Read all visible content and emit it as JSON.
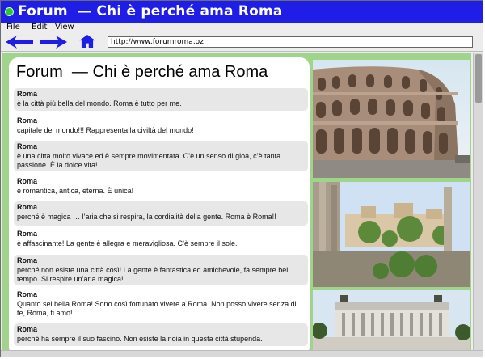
{
  "window": {
    "title": "Forum  — Chi è perché ama Roma"
  },
  "menu": {
    "items": [
      "File",
      "Edit",
      "View"
    ]
  },
  "toolbar": {
    "url": "http://www.forumroma.oz"
  },
  "page": {
    "heading": "Forum  — Chi è perché ama Roma",
    "posts": [
      {
        "author": "Roma",
        "text": "è la città più bella del mondo. Roma è tutto per me."
      },
      {
        "author": "Roma",
        "text": "capitale del mondo!!! Rappresenta la civiltà del mondo!"
      },
      {
        "author": "Roma",
        "text": "è una città molto vivace ed è sempre movimentata. C’è un senso di gioa, c’è tanta passione. È la dolce vita!"
      },
      {
        "author": "Roma",
        "text": "è romantica, antica, eterna. È unica!"
      },
      {
        "author": "Roma",
        "text": "perché è magica … l’aria che si respira, la cordialità della gente. Roma è Roma!!"
      },
      {
        "author": "Roma",
        "text": "è affascinante! La gente è allegra e meravigliosa. C’è sempre il sole."
      },
      {
        "author": "Roma",
        "text": "perché non esiste una città così! La gente è fantastica ed amichevole, fa sempre bel tempo. Si respire un’aria magica!"
      },
      {
        "author": "Roma",
        "text": "Quanto sei bella Roma! Sono così fortunato vivere a Roma. Non posso vivere senza di te, Roma, ti amo!"
      },
      {
        "author": "Roma",
        "text": "perché ha sempre il suo fascino. Non esiste la noia in questa città stupenda."
      }
    ]
  },
  "icons": {
    "back": "left-arrow-icon",
    "forward": "right-arrow-icon",
    "home": "home-icon"
  },
  "colors": {
    "titlebar": "#1e1ee6",
    "content_bg": "#9fd48a",
    "post_shade": "#e7e7e7",
    "toolbar_icons": "#1e1ee6"
  },
  "photos": [
    "colosseum-photo",
    "roman-forum-photo",
    "vittoriano-photo"
  ]
}
